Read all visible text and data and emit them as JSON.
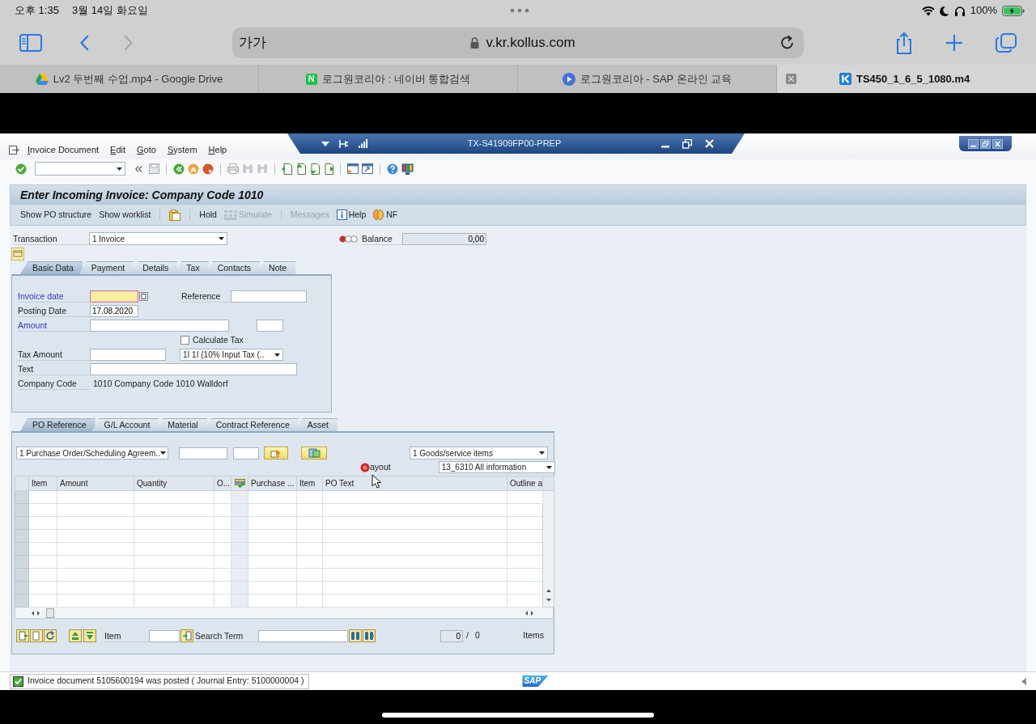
{
  "ipad_status": {
    "time": "오후 1:35",
    "date": "3월 14일 화요일",
    "battery": "100%"
  },
  "browser": {
    "text_size_button": "가가",
    "url": "v.kr.kollus.com",
    "forward_disabled": true,
    "tabs": [
      {
        "kind": "drive",
        "title": "Lv2 두번째 수업.mp4 - Google Drive",
        "selected": false
      },
      {
        "kind": "letter",
        "favicon_text": "N",
        "title": "로그원코리아 : 네이버 통합검색",
        "selected": false
      },
      {
        "kind": "play",
        "title": "로그원코리아 - SAP 온라인 교육",
        "selected": false
      },
      {
        "kind": "player",
        "title": "TS450_1_6_5_1080.m4",
        "selected": true
      }
    ]
  },
  "sap": {
    "menu": [
      "Invoice Document",
      "Edit",
      "Goto",
      "System",
      "Help"
    ],
    "system_title": "TX-S41909FP00-PREP",
    "screen_title": "Enter Incoming Invoice: Company Code 1010",
    "app_toolbar": [
      {
        "kind": "text",
        "label": "Show PO structure",
        "disabled": false
      },
      {
        "kind": "text",
        "label": "Show worklist",
        "disabled": false
      },
      {
        "kind": "separator"
      },
      {
        "kind": "clipboard",
        "disabled": false
      },
      {
        "kind": "separator"
      },
      {
        "kind": "text",
        "label": "Hold",
        "disabled": false
      },
      {
        "kind": "grid",
        "label": "Simulate",
        "disabled": true
      },
      {
        "kind": "separator"
      },
      {
        "kind": "text",
        "label": "Messages",
        "disabled": true
      },
      {
        "kind": "info",
        "label": "Help",
        "disabled": false
      },
      {
        "kind": "coins",
        "label": "NF",
        "disabled": false
      }
    ],
    "transaction": {
      "label": "Transaction",
      "value": "1 Invoice"
    },
    "balance": {
      "label": "Balance",
      "value": "0,00",
      "error": true
    },
    "header_tabs": [
      {
        "label": "Basic Data",
        "selected": true
      },
      {
        "label": "Payment",
        "selected": false
      },
      {
        "label": "Details",
        "selected": false
      },
      {
        "label": "Tax",
        "selected": false
      },
      {
        "label": "Contacts",
        "selected": false
      },
      {
        "label": "Note",
        "selected": false
      }
    ],
    "basic_data": {
      "invoice_date": {
        "label": "Invoice date",
        "required": true,
        "focused": true
      },
      "reference": {
        "label": "Reference",
        "required": false
      },
      "posting_date": {
        "label": "Posting Date",
        "value": "17.08.2020",
        "required": false
      },
      "amount": {
        "label": "Amount",
        "required": true
      },
      "calculate_tax": {
        "label": "Calculate Tax",
        "checked": false
      },
      "tax_amount": {
        "label": "Tax Amount",
        "required": false
      },
      "tax_code": {
        "value": "1I 1I (10% Input Tax (.."
      },
      "text": {
        "label": "Text",
        "required": false
      },
      "company_code": {
        "label": "Company Code",
        "value": "1010 Company Code 1010 Walldorf"
      }
    },
    "item_tabs": [
      {
        "label": "PO Reference",
        "selected": true
      },
      {
        "label": "G/L Account",
        "selected": false
      },
      {
        "label": "Material",
        "selected": false
      },
      {
        "label": "Contract Reference",
        "selected": false
      },
      {
        "label": "Asset",
        "selected": false
      }
    ],
    "po_reference": {
      "document_type": "1 Purchase Order/Scheduling Agreem..",
      "item_list_type": "1 Goods/service items",
      "layout_label": "ayout",
      "layout": "13_6310 All information",
      "columns": [
        {
          "kind": "text",
          "label": "Item"
        },
        {
          "kind": "text",
          "label": "Amount"
        },
        {
          "kind": "text",
          "label": "Quantity"
        },
        {
          "kind": "text",
          "label": "O..."
        },
        {
          "kind": "icon"
        },
        {
          "kind": "text",
          "label": "Purchase ..."
        },
        {
          "kind": "text",
          "label": "Item"
        },
        {
          "kind": "text",
          "label": "PO Text"
        },
        {
          "kind": "text",
          "label": "Outline a"
        }
      ],
      "item_label": "Item",
      "search_label": "Search Term",
      "counter_value": "0",
      "counter_separator": "/",
      "counter_total": "0",
      "counter_unit": "Items"
    },
    "message": {
      "kind": "success",
      "text": "Invoice document 5105600194 was posted ( Journal Entry: 5100000004 )"
    },
    "logo_text": "SAP"
  }
}
